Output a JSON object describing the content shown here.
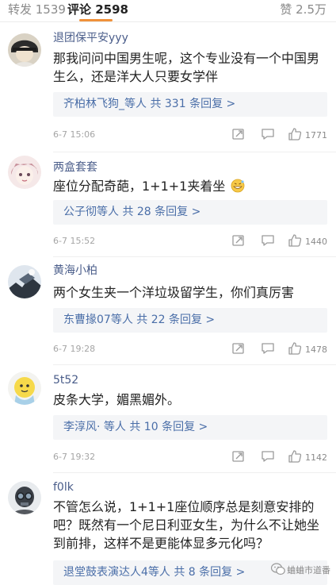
{
  "tabs": {
    "repost_label": "转发 1539",
    "comment_label": "评论 2598",
    "like_label": "赞 2.5万"
  },
  "comments": [
    {
      "username": "退团保平安yyy",
      "text": "那我问问中国男生呢，这个专业没有一个中国男生么，还是洋大人只要女学伴",
      "reply_summary": "齐柏林飞狗_等人 共 331 条回复 >",
      "timestamp": "6-7 15:06",
      "likes": "1771"
    },
    {
      "username": "两盒套套",
      "text": "座位分配奇葩，1+1+1夹着坐",
      "reply_summary": "公子彻等人 共 28 条回复 >",
      "timestamp": "6-7 15:52",
      "likes": "1440"
    },
    {
      "username": "黄海小柏",
      "text": "两个女生夹一个洋垃圾留学生，你们真厉害",
      "reply_summary": "东曹掾07等人 共 22 条回复 >",
      "timestamp": "6-7 19:28",
      "likes": "1478"
    },
    {
      "username": "5t52",
      "text": "皮条大学，媚黑媚外。",
      "reply_summary": "李淳风· 等人 共 10 条回复 >",
      "timestamp": "6-7 19:32",
      "likes": "1142"
    },
    {
      "username": "f0lk",
      "text": "不管怎么说，1+1+1座位顺序总是刻意安排的吧？既然有一个尼日利亚女生，为什么不让她坐到前排，这样不是更能体显多元化吗？",
      "reply_summary": "退堂鼓表演达人4等人 共 8 条回复 >",
      "timestamp": "",
      "likes": ""
    }
  ],
  "watermark": "蛐蛐市道番",
  "colors": {
    "accent_tab": "#f0913a",
    "username": "#4a5d8a",
    "reply_link": "#4a6ea8",
    "reply_bg": "#f4f5f7"
  },
  "icons": [
    "share-icon",
    "comment-icon",
    "like-icon",
    "grin-emoji-icon",
    "wechat-icon"
  ]
}
